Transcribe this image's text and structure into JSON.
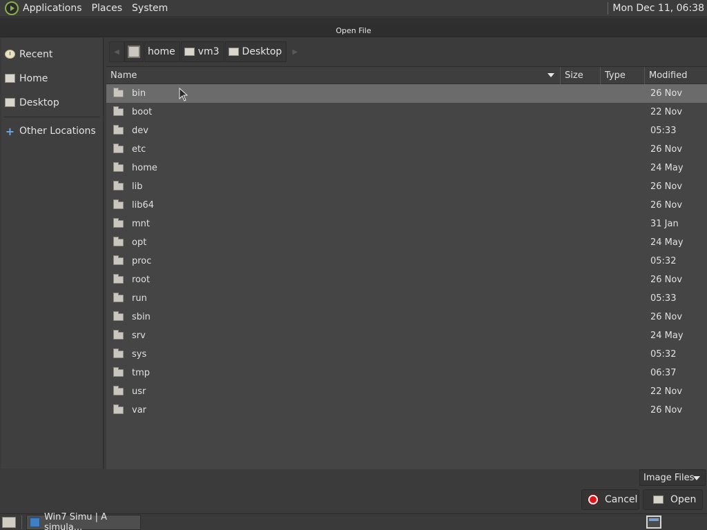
{
  "top_panel": {
    "menus": [
      "Applications",
      "Places",
      "System"
    ],
    "clock": "Mon Dec 11, 06:38"
  },
  "dialog": {
    "title": "Open File"
  },
  "sidebar": {
    "items": [
      {
        "label": "Recent",
        "icon": "recent-icon"
      },
      {
        "label": "Home",
        "icon": "home-folder-icon"
      },
      {
        "label": "Desktop",
        "icon": "desktop-folder-icon"
      },
      {
        "label": "Other Locations",
        "icon": "plus-icon"
      }
    ]
  },
  "pathbar": {
    "crumbs": [
      "home",
      "vm3",
      "Desktop"
    ]
  },
  "list": {
    "columns": {
      "name": "Name",
      "size": "Size",
      "type": "Type",
      "modified": "Modified"
    },
    "rows": [
      {
        "name": "bin",
        "modified": "26 Nov"
      },
      {
        "name": "boot",
        "modified": "22 Nov"
      },
      {
        "name": "dev",
        "modified": "05:33"
      },
      {
        "name": "etc",
        "modified": "26 Nov"
      },
      {
        "name": "home",
        "modified": "24 May"
      },
      {
        "name": "lib",
        "modified": "26 Nov"
      },
      {
        "name": "lib64",
        "modified": "26 Nov"
      },
      {
        "name": "mnt",
        "modified": "31 Jan"
      },
      {
        "name": "opt",
        "modified": "24 May"
      },
      {
        "name": "proc",
        "modified": "05:32"
      },
      {
        "name": "root",
        "modified": "26 Nov"
      },
      {
        "name": "run",
        "modified": "05:33"
      },
      {
        "name": "sbin",
        "modified": "26 Nov"
      },
      {
        "name": "srv",
        "modified": "24 May"
      },
      {
        "name": "sys",
        "modified": "05:32"
      },
      {
        "name": "tmp",
        "modified": "06:37"
      },
      {
        "name": "usr",
        "modified": "22 Nov"
      },
      {
        "name": "var",
        "modified": "26 Nov"
      }
    ]
  },
  "footer": {
    "filter": "Image Files",
    "cancel": "Cancel",
    "open": "Open"
  },
  "taskbar": {
    "task": "Win7 Simu | A simula..."
  }
}
